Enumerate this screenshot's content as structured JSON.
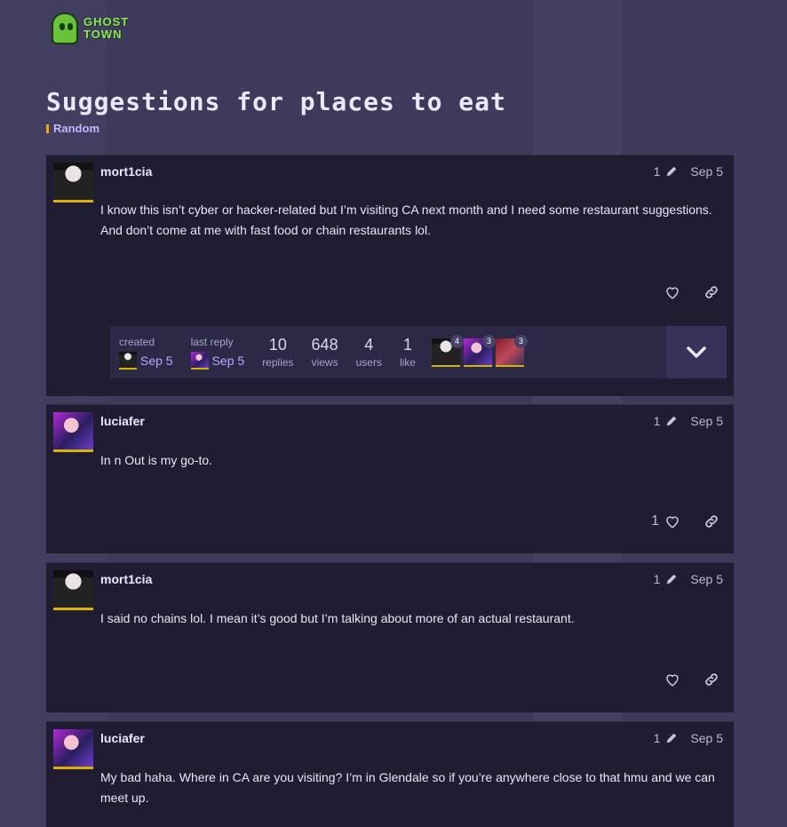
{
  "site": {
    "logo_text_line1": "GHOST",
    "logo_text_line2": "TOWN"
  },
  "topic": {
    "title": "Suggestions for places to eat",
    "category": "Random",
    "category_color": "#f0a500"
  },
  "posts": [
    {
      "username": "mort1cia",
      "edits": "1",
      "date": "Sep 5",
      "body": "I know this isn’t cyber or hacker-related but I’m visiting CA next month and I need some restaurant suggestions. And don’t come at me with fast food or chain restaurants lol.",
      "likes": ""
    },
    {
      "username": "luciafer",
      "edits": "1",
      "date": "Sep 5",
      "body": "In n Out is my go-to.",
      "likes": "1"
    },
    {
      "username": "mort1cia",
      "edits": "1",
      "date": "Sep 5",
      "body": "I said no chains lol. I mean it’s good but I’m talking about more of an actual restaurant.",
      "likes": ""
    },
    {
      "username": "luciafer",
      "edits": "1",
      "date": "Sep 5",
      "body": "My bad haha. Where in CA are you visiting? I’m in Glendale so if you’re anywhere close to that hmu and we can meet up.",
      "likes": ""
    }
  ],
  "topic_map": {
    "created_label": "created",
    "created_date": "Sep 5",
    "last_reply_label": "last reply",
    "last_reply_date": "Sep 5",
    "stats": [
      {
        "value": "10",
        "label": "replies"
      },
      {
        "value": "648",
        "label": "views"
      },
      {
        "value": "4",
        "label": "users"
      },
      {
        "value": "1",
        "label": "like"
      }
    ],
    "participants": [
      {
        "count": "4"
      },
      {
        "count": "3"
      },
      {
        "count": "3"
      }
    ]
  }
}
